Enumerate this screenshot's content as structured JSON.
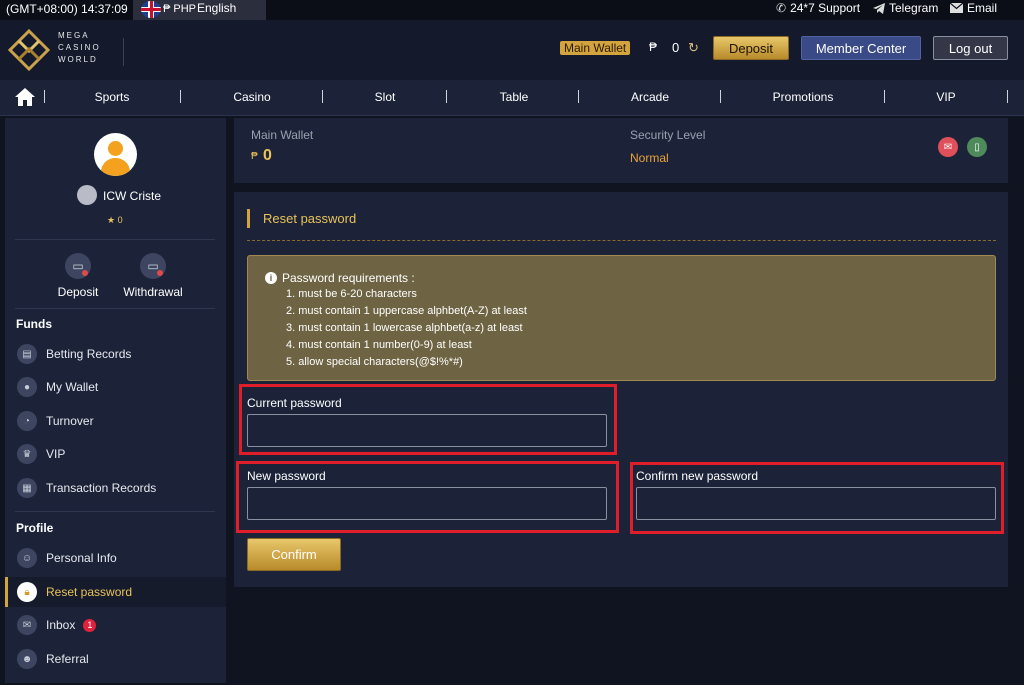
{
  "topbar": {
    "time": "(GMT+08:00) 14:37:09",
    "currency": "₱ PHP",
    "language": "English",
    "links": [
      {
        "label": "24*7 Support",
        "icon": "phone-icon"
      },
      {
        "label": "Telegram",
        "icon": "telegram-icon"
      },
      {
        "label": "Email",
        "icon": "email-icon"
      }
    ]
  },
  "header": {
    "logo": {
      "line1": "MEGA",
      "line2": "CASINO",
      "line3": "WORLD"
    },
    "wallet_badge": "Main Wallet",
    "currency_symbol": "₱",
    "balance": "0",
    "deposit_label": "Deposit",
    "member_center_label": "Member Center",
    "logout_label": "Log out"
  },
  "nav": {
    "items": [
      "Sports",
      "Casino",
      "Slot",
      "Table",
      "Arcade",
      "Promotions",
      "VIP"
    ]
  },
  "sidebar": {
    "username": "ICW Criste",
    "stars": "★ 0",
    "quick_actions": [
      "Deposit",
      "Withdrawal"
    ],
    "funds_title": "Funds",
    "funds_items": [
      "Betting Records",
      "My Wallet",
      "Turnover",
      "VIP",
      "Transaction Records"
    ],
    "profile_title": "Profile",
    "profile_items": [
      "Personal Info",
      "Reset password",
      "Inbox",
      "Referral"
    ],
    "inbox_count": "1",
    "active_item": "Reset password"
  },
  "wallet_panel": {
    "main_wallet_label": "Main Wallet",
    "currency_symbol": "₱",
    "main_wallet_value": "0",
    "security_label": "Security Level",
    "security_value": "Normal"
  },
  "reset": {
    "title": "Reset password",
    "requirements_title": "Password requirements :",
    "requirements": [
      "1. must be 6-20 characters",
      "2. must contain 1 uppercase alphbet(A-Z) at least",
      "3. must contain 1 lowercase alphbet(a-z) at least",
      "4. must contain 1 number(0-9) at least",
      "5. allow special characters(@$!%*#)"
    ],
    "current_label": "Current password",
    "new_label": "New password",
    "confirm_label": "Confirm new password",
    "confirm_button": "Confirm"
  },
  "colors": {
    "accent_gold": "#d3a33d",
    "highlight_red": "#e01e2a",
    "panel_bg": "#1c2338"
  }
}
